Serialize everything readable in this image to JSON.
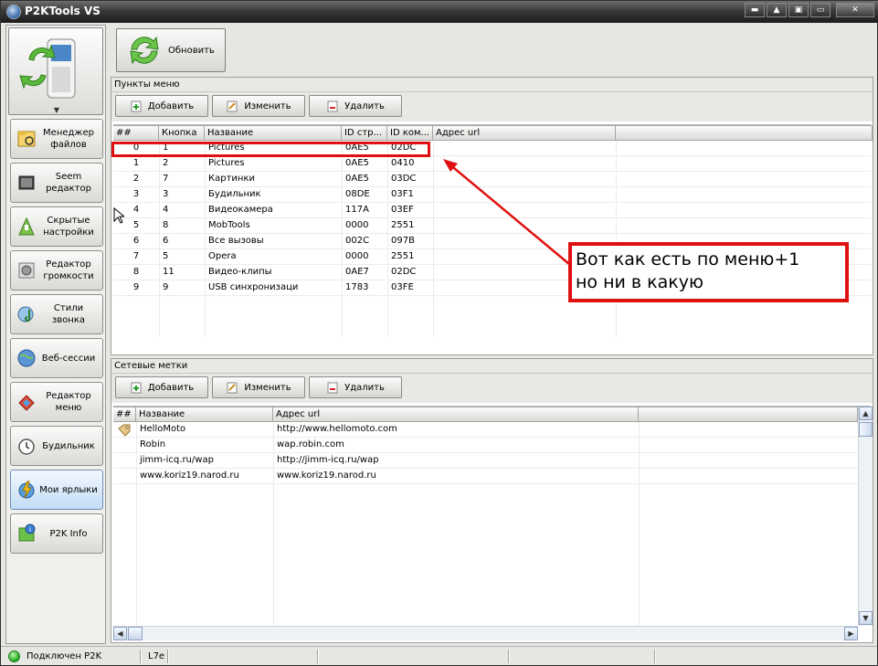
{
  "window": {
    "title": "P2KTools VS",
    "controls": [
      "▬",
      "▲",
      "▣",
      "▭",
      "✕"
    ]
  },
  "sidebar": {
    "items": [
      {
        "label": "Менеджер файлов",
        "icon": "file-manager-icon"
      },
      {
        "label": "Seem редактор",
        "icon": "seem-editor-icon"
      },
      {
        "label": "Скрытые настройки",
        "icon": "hidden-settings-icon"
      },
      {
        "label": "Редактор громкости",
        "icon": "volume-editor-icon"
      },
      {
        "label": "Стили звонка",
        "icon": "ringtone-styles-icon"
      },
      {
        "label": "Веб-сессии",
        "icon": "web-sessions-icon"
      },
      {
        "label": "Редактор меню",
        "icon": "menu-editor-icon"
      },
      {
        "label": "Будильник",
        "icon": "alarm-clock-icon"
      },
      {
        "label": "Мои ярлыки",
        "icon": "my-shortcuts-icon",
        "active": true
      },
      {
        "label": "P2K Info",
        "icon": "p2k-info-icon"
      }
    ]
  },
  "main": {
    "refresh_label": "Обновить",
    "menu_section": {
      "title": "Пункты меню",
      "buttons": {
        "add": "Добавить",
        "edit": "Изменить",
        "delete": "Удалить"
      },
      "columns": [
        "##",
        "Кнопка",
        "Название",
        "ID стр...",
        "ID ком...",
        "Адрес url"
      ],
      "rows": [
        [
          "0",
          "1",
          "Pictures",
          "0AE5",
          "02DC",
          ""
        ],
        [
          "1",
          "2",
          "Pictures",
          "0AE5",
          "0410",
          ""
        ],
        [
          "2",
          "7",
          "Картинки",
          "0AE5",
          "03DC",
          ""
        ],
        [
          "3",
          "3",
          "Будильник",
          "08DE",
          "03F1",
          ""
        ],
        [
          "4",
          "4",
          "Видеокамера",
          "117A",
          "03EF",
          ""
        ],
        [
          "5",
          "8",
          "MobTools",
          "0000",
          "2551",
          ""
        ],
        [
          "6",
          "6",
          "Все вызовы",
          "002C",
          "097B",
          ""
        ],
        [
          "7",
          "5",
          "Opera",
          "0000",
          "2551",
          ""
        ],
        [
          "8",
          "11",
          "Видео-клипы",
          "0AE7",
          "02DC",
          ""
        ],
        [
          "9",
          "9",
          "USB синхронизаци",
          "1783",
          "03FE",
          ""
        ]
      ]
    },
    "bookmarks_section": {
      "title": "Сетевые метки",
      "buttons": {
        "add": "Добавить",
        "edit": "Изменить",
        "delete": "Удалить"
      },
      "columns": [
        "##",
        "Название",
        "Адрес url"
      ],
      "rows": [
        [
          "",
          "HelloMoto",
          "http://www.hellomoto.com"
        ],
        [
          "",
          "Robin",
          "wap.robin.com"
        ],
        [
          "",
          "jimm-icq.ru/wap",
          "http://jimm-icq.ru/wap"
        ],
        [
          "",
          "www.koriz19.narod.ru",
          "www.koriz19.narod.ru"
        ]
      ]
    }
  },
  "annotation": {
    "line1": "Вот как есть по меню+1",
    "line2": "но ни в какую",
    "color": "#e01010"
  },
  "statusbar": {
    "connection": "Подключен P2K",
    "model": "L7e"
  }
}
